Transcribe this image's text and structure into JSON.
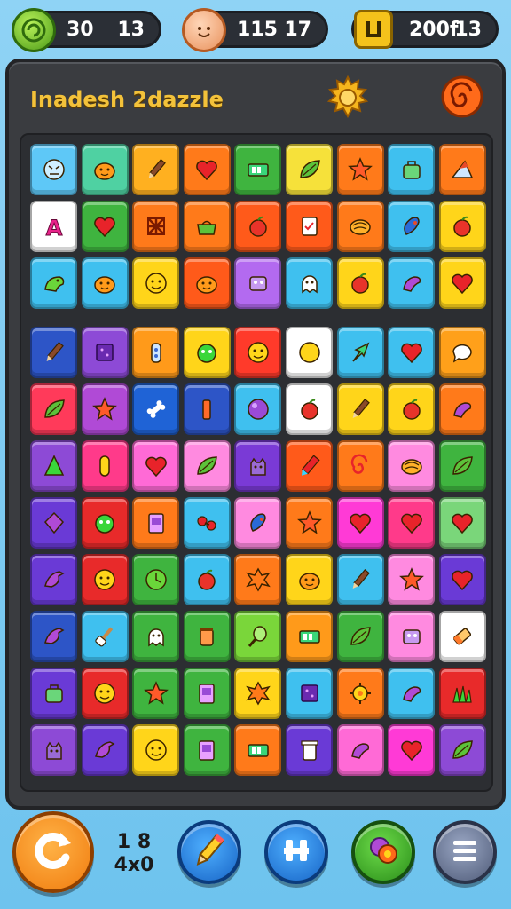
{
  "top_bar": {
    "coins": {
      "value": "30",
      "secondary": "13",
      "icon": "coin-icon"
    },
    "lives": {
      "value": "115",
      "secondary": "17",
      "icon": "face-icon"
    },
    "score": {
      "value": "200f",
      "secondary": "13",
      "icon": "box-icon"
    }
  },
  "header": {
    "title": "Inadesh 2dazzle",
    "settings_icon": "gear-icon",
    "spiral_icon": "spiral-icon"
  },
  "board": {
    "rows": [
      [
        [
          "#5ec8f7",
          "circle-face"
        ],
        [
          "#4fd1a2",
          "pumpkin"
        ],
        [
          "#ffb020",
          "pencil"
        ],
        [
          "#ff7a1a",
          "heart"
        ],
        [
          "#3fb43f",
          "battery"
        ],
        [
          "#f6e13a",
          "leaf"
        ],
        [
          "#ff7a1a",
          "star"
        ],
        [
          "#3fc0ef",
          "bag"
        ],
        [
          "#ff7a1a",
          "wedge"
        ]
      ],
      [
        [
          "#ffffff",
          "letter-a"
        ],
        [
          "#3fb43f",
          "heart"
        ],
        [
          "#ff7a1a",
          "knot"
        ],
        [
          "#ff7a1a",
          "pot"
        ],
        [
          "#ff5a1a",
          "apple"
        ],
        [
          "#ff5a1a",
          "note"
        ],
        [
          "#ff7a1a",
          "shell"
        ],
        [
          "#3fc0ef",
          "bean"
        ],
        [
          "#ffd51a",
          "apple"
        ]
      ],
      [
        [
          "#3fc0ef",
          "dino"
        ],
        [
          "#3fc0ef",
          "pumpkin"
        ],
        [
          "#ffd51a",
          "face"
        ],
        [
          "#ff5a1a",
          "pumpkin"
        ],
        [
          "#b36af0",
          "robot"
        ],
        [
          "#3fc0ef",
          "ghost"
        ],
        [
          "#ffd51a",
          "apple"
        ],
        [
          "#3fc0ef",
          "worm"
        ],
        [
          "#ffd51a",
          "heart"
        ]
      ],
      [
        [
          "#2d55c7",
          "pencil"
        ],
        [
          "#8d4ad6",
          "box"
        ],
        [
          "#ff9a1a",
          "bottle"
        ],
        [
          "#ffd51a",
          "frog"
        ],
        [
          "#ff3a2a",
          "face"
        ],
        [
          "#ffffff",
          "circle"
        ],
        [
          "#3fc0ef",
          "arrow"
        ],
        [
          "#3fc0ef",
          "heart"
        ],
        [
          "#ffa01a",
          "bubble"
        ]
      ],
      [
        [
          "#ff3a5a",
          "leaf"
        ],
        [
          "#b04ad6",
          "star"
        ],
        [
          "#1f63d6",
          "bone"
        ],
        [
          "#2d55c7",
          "tube"
        ],
        [
          "#3fc0ef",
          "ball"
        ],
        [
          "#ffffff",
          "apple"
        ],
        [
          "#ffd51a",
          "pencil"
        ],
        [
          "#ffd51a",
          "apple"
        ],
        [
          "#ff7a1a",
          "worm"
        ]
      ],
      [
        [
          "#8d4ad6",
          "cone"
        ],
        [
          "#ff3a8a",
          "pill"
        ],
        [
          "#ff6ad6",
          "heart"
        ],
        [
          "#ff8ae0",
          "leaf"
        ],
        [
          "#7a3ad6",
          "cat"
        ],
        [
          "#ff5a1a",
          "crayon"
        ],
        [
          "#ff7a1a",
          "spiral"
        ],
        [
          "#ff8ae0",
          "shell"
        ],
        [
          "#3fb43f",
          "leaf"
        ]
      ],
      [
        [
          "#6a3ad6",
          "gem"
        ],
        [
          "#e82a2a",
          "frog"
        ],
        [
          "#ff7a1a",
          "card"
        ],
        [
          "#3fc0ef",
          "berries"
        ],
        [
          "#ff8ae0",
          "bean"
        ],
        [
          "#ff7a1a",
          "star"
        ],
        [
          "#ff3ad6",
          "heart"
        ],
        [
          "#ff3a8a",
          "heart"
        ],
        [
          "#7ad67a",
          "heart"
        ]
      ],
      [
        [
          "#6a3ad6",
          "bird"
        ],
        [
          "#e82a2a",
          "face"
        ],
        [
          "#3fb43f",
          "clock"
        ],
        [
          "#3fc0ef",
          "apple"
        ],
        [
          "#ff7a1a",
          "splat"
        ],
        [
          "#ffd51a",
          "pumpkin"
        ],
        [
          "#3fc0ef",
          "pencil"
        ],
        [
          "#ff8ae0",
          "star"
        ],
        [
          "#6a3ad6",
          "heart"
        ]
      ],
      [
        [
          "#2d55c7",
          "bird"
        ],
        [
          "#3fc0ef",
          "shovel"
        ],
        [
          "#3fb43f",
          "ghost"
        ],
        [
          "#3fb43f",
          "jar"
        ],
        [
          "#7ad63a",
          "racket"
        ],
        [
          "#ff9a1a",
          "battery"
        ],
        [
          "#3fb43f",
          "leaf"
        ],
        [
          "#ff8ae0",
          "robot"
        ],
        [
          "#ffffff",
          "eraser"
        ]
      ],
      [
        [
          "#6a3ad6",
          "bag"
        ],
        [
          "#e82a2a",
          "face"
        ],
        [
          "#3fb43f",
          "star"
        ],
        [
          "#3fb43f",
          "card"
        ],
        [
          "#ffd51a",
          "splat"
        ],
        [
          "#3fc0ef",
          "box"
        ],
        [
          "#ff7a1a",
          "gear"
        ],
        [
          "#3fc0ef",
          "worm"
        ],
        [
          "#e82a2a",
          "grass"
        ]
      ],
      [
        [
          "#8d4ad6",
          "cat"
        ],
        [
          "#6a3ad6",
          "bird"
        ],
        [
          "#ffd51a",
          "face"
        ],
        [
          "#3fb43f",
          "card"
        ],
        [
          "#ff7a1a",
          "battery"
        ],
        [
          "#6a3ad6",
          "trash"
        ],
        [
          "#ff6ad6",
          "worm"
        ],
        [
          "#ff3ad6",
          "heart"
        ],
        [
          "#8d4ad6",
          "leaf"
        ]
      ]
    ]
  },
  "bottom_bar": {
    "restart_icon": "restart-icon",
    "moves_line1": "1 8",
    "moves_line2": "4x0",
    "pencil_icon": "pencil-icon",
    "shuffle_icon": "shuffle-icon",
    "hint_icon": "hint-icon",
    "menu_icon": "menu-icon"
  }
}
